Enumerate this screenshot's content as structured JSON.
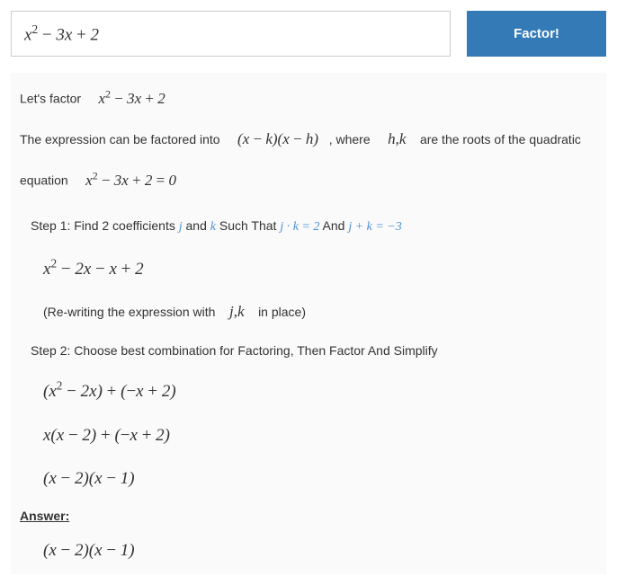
{
  "input": {
    "expression_html": "<span class='math big'>x<sup>2</sup> <span class='rm'>−</span> 3x <span class='rm'>+</span> 2</span>"
  },
  "button": {
    "label": "Factor!"
  },
  "intro": {
    "lets_factor": "Let's factor",
    "expr_html": "<span class='math'>x<sup>2</sup> <span class='rm'>−</span> 3x <span class='rm'>+</span> 2</span>",
    "sentence_pre": "The expression can be factored into",
    "factored_form_html": "<span class='math'>(x <span class='rm'>−</span> k)(x <span class='rm'>−</span> h)</span>",
    "where": ", where",
    "hk_html": "<span class='math'>h<span class='rm'>,</span>k</span>",
    "roots_text": "are the roots of the quadratic",
    "equation_word": "equation",
    "equation_html": "<span class='math'>x<sup>2</sup> <span class='rm'>−</span> 3x <span class='rm'>+</span> 2 <span class='rm'>=</span> 0</span>"
  },
  "step1": {
    "label_pre": "Step 1: Find 2 coefficients ",
    "j_html": "<span class='accent'>j</span>",
    "and": " and ",
    "k_html": "<span class='accent'>k</span>",
    "such_that": " Such That ",
    "cond1_html": "<span class='accent'>j · k <span class='rm' style='color:#4a90d9'>=</span> <span class='rm' style='color:#4a90d9'>2</span></span>",
    "and2": " And ",
    "cond2_html": "<span class='accent'>j <span class='rm' style='color:#4a90d9'>+</span> k <span class='rm' style='color:#4a90d9'>=</span> <span class='rm' style='color:#4a90d9'>−3</span></span>",
    "rewrite_html": "<span class='math big'>x<sup>2</sup> <span class='rm'>−</span> 2x <span class='rm'>−</span> x <span class='rm'>+</span> 2</span>",
    "note_pre": "(Re-writing the expression with",
    "jk_html": "<span class='math'>j<span class='rm'>,</span>k</span>",
    "note_post": "in place)"
  },
  "step2": {
    "label": "Step 2: Choose best combination for Factoring, Then Factor And Simplify",
    "line1_html": "<span class='math big'>(x<sup>2</sup> <span class='rm'>−</span> 2x) <span class='rm'>+</span> (<span class='rm'>−</span>x <span class='rm'>+</span> 2)</span>",
    "line2_html": "<span class='math big'>x(x <span class='rm'>−</span> 2) <span class='rm'>+</span> (<span class='rm'>−</span>x <span class='rm'>+</span> 2)</span>",
    "line3_html": "<span class='math big'>(x <span class='rm'>−</span> 2)(x <span class='rm'>−</span> 1)</span>"
  },
  "answer": {
    "label": "Answer:",
    "value_html": "<span class='math big'>(x <span class='rm'>−</span> 2)(x <span class='rm'>−</span> 1)</span>"
  }
}
